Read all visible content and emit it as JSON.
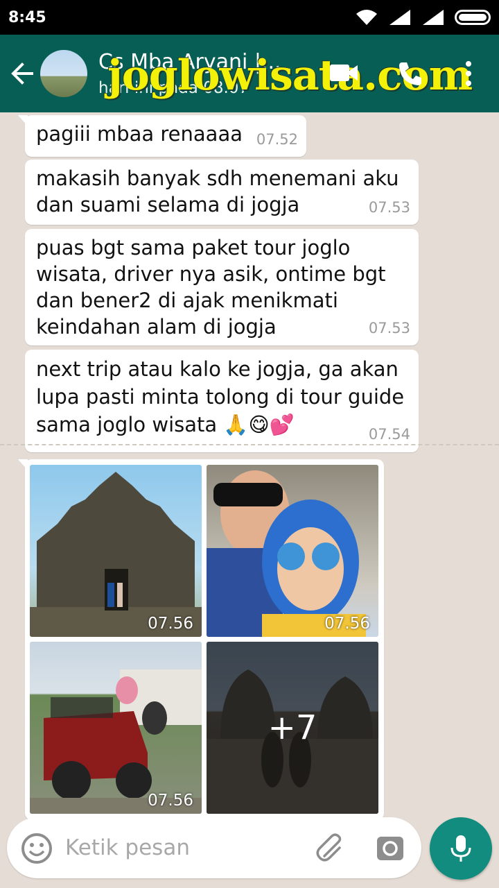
{
  "status_bar": {
    "time": "8:45"
  },
  "header": {
    "contact_name": "Cs Mba Aryani |...",
    "last_seen": "hari ini pada 08.07",
    "watermark": "joglowisata.com",
    "icons": [
      "back-arrow-icon",
      "video-call-icon",
      "phone-icon",
      "more-vert-icon"
    ],
    "color": "#075e54"
  },
  "messages": [
    {
      "text": "pagiii mbaa renaaaa",
      "time": "07.52"
    },
    {
      "text": "makasih banyak sdh menemani aku\ndan suami selama di jogja",
      "time": "07.53"
    },
    {
      "text": "puas bgt sama paket tour joglo\nwisata, driver nya asik, ontime bgt\ndan bener2 di ajak menikmati\nkeindahan alam di jogja",
      "time": "07.53"
    },
    {
      "text": "next trip atau kalo ke jogja, ga akan\nlupa pasti minta tolong di tour guide\nsama joglo wisata 🙏😋💕",
      "time": "07.54"
    }
  ],
  "photos": [
    {
      "subject": "temple",
      "time": "07.56"
    },
    {
      "subject": "selfie",
      "time": "07.56"
    },
    {
      "subject": "jeep",
      "time": "07.56"
    },
    {
      "subject": "stupa",
      "more": "+7"
    }
  ],
  "input": {
    "placeholder": "Ketik pesan"
  },
  "accent_color": "#128c7e"
}
